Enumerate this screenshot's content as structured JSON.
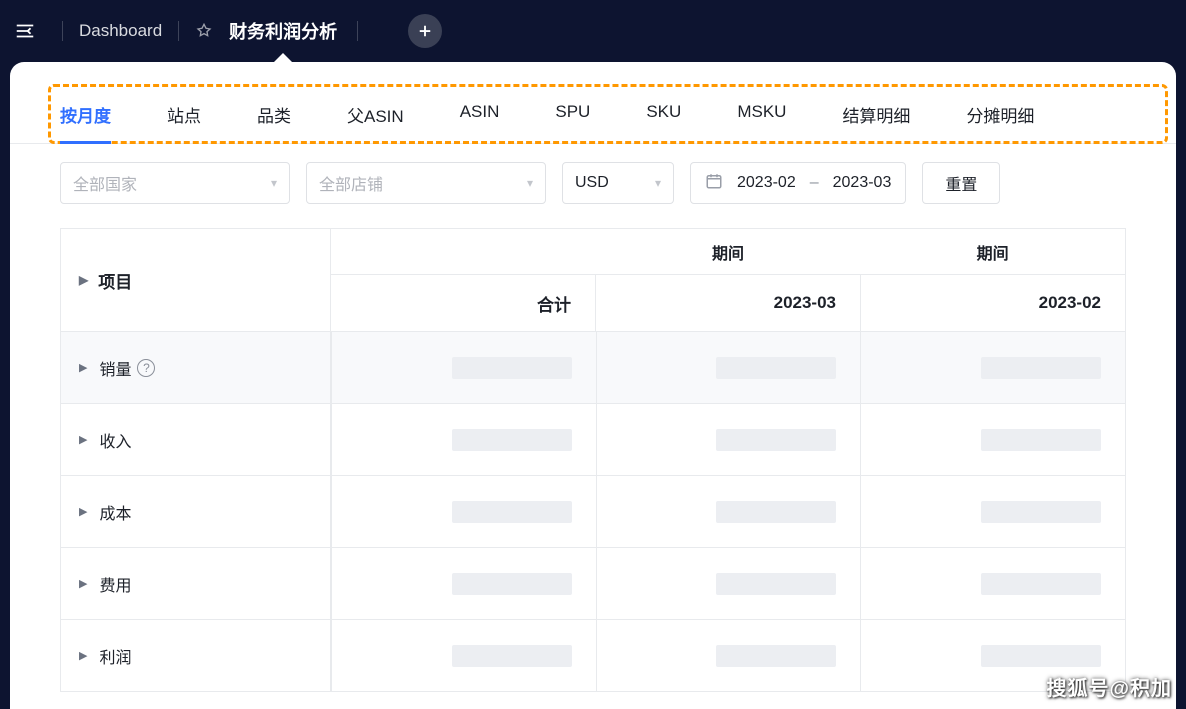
{
  "topbar": {
    "dashboard": "Dashboard",
    "title": "财务利润分析"
  },
  "tabs": [
    "按月度",
    "站点",
    "品类",
    "父ASIN",
    "ASIN",
    "SPU",
    "SKU",
    "MSKU",
    "结算明细",
    "分摊明细"
  ],
  "filters": {
    "country": "全部国家",
    "store": "全部店铺",
    "currency": "USD",
    "date_from": "2023-02",
    "date_to": "2023-03",
    "reset": "重置"
  },
  "table": {
    "row_header": "项目",
    "period_label": "期间",
    "columns": [
      "合计",
      "2023-03",
      "2023-02"
    ],
    "rows": [
      {
        "label": "销量",
        "help": true
      },
      {
        "label": "收入",
        "help": false
      },
      {
        "label": "成本",
        "help": false
      },
      {
        "label": "费用",
        "help": false
      },
      {
        "label": "利润",
        "help": false
      }
    ]
  },
  "watermark": "搜狐号@积加"
}
